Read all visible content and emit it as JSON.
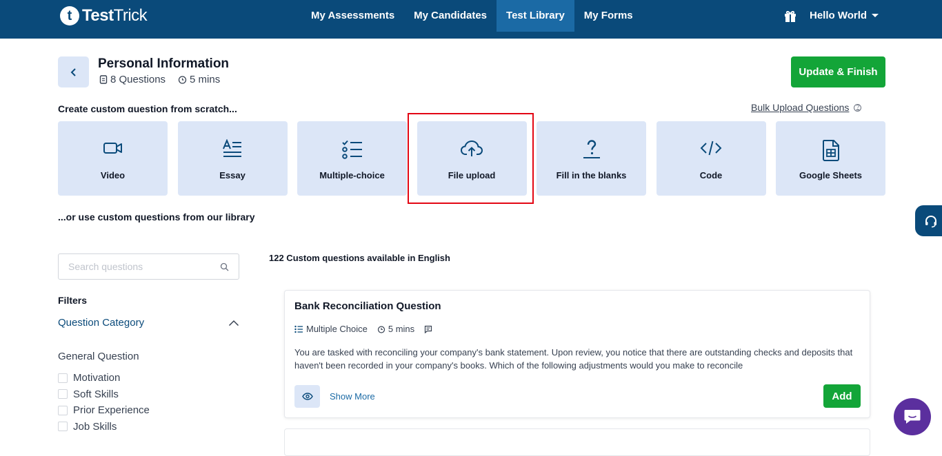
{
  "brand": {
    "letter": "t",
    "name_bold": "Test",
    "name_light": "Trick"
  },
  "nav": [
    {
      "label": "My Assessments",
      "active": false
    },
    {
      "label": "My Candidates",
      "active": false
    },
    {
      "label": "Test Library",
      "active": true
    },
    {
      "label": "My Forms",
      "active": false
    }
  ],
  "user": {
    "name": "Hello World"
  },
  "header": {
    "title": "Personal Information",
    "questions": "8 Questions",
    "duration": "5 mins",
    "update_label": "Update & Finish"
  },
  "create": {
    "label": "Create custom question from scratch...",
    "bulk_label": "Bulk Upload Questions",
    "help": "?"
  },
  "question_types": [
    {
      "label": "Video",
      "icon": "video-icon"
    },
    {
      "label": "Essay",
      "icon": "essay-icon"
    },
    {
      "label": "Multiple-choice",
      "icon": "multiple-choice-icon"
    },
    {
      "label": "File upload",
      "icon": "cloud-upload-icon"
    },
    {
      "label": "Fill in the blanks",
      "icon": "question-mark-icon"
    },
    {
      "label": "Code",
      "icon": "code-icon"
    },
    {
      "label": "Google Sheets",
      "icon": "spreadsheet-icon"
    }
  ],
  "library": {
    "label": "...or use custom questions from our library",
    "count_text": "122 Custom questions available in English"
  },
  "search": {
    "placeholder": "Search questions",
    "value": ""
  },
  "filters": {
    "title": "Filters",
    "category_label": "Question Category",
    "group_label": "General Question",
    "options": [
      "Motivation",
      "Soft Skills",
      "Prior Experience",
      "Job Skills"
    ]
  },
  "question_card": {
    "title": "Bank Reconciliation Question",
    "type": "Multiple Choice",
    "duration": "5 mins",
    "description": "You are tasked with reconciling your company's bank statement. Upon review, you notice that there are outstanding checks and deposits that haven't been recorded in your company's books. Which of the following adjustments would you make to reconcile",
    "show_more": "Show More",
    "add_label": "Add"
  },
  "colors": {
    "nav_bg": "#0a4a7a",
    "nav_active": "#1b6aa5",
    "accent_green": "#13a538",
    "card_bg": "#dce6f7",
    "highlight": "#e30613",
    "chat_bg": "#5b2f9e"
  }
}
